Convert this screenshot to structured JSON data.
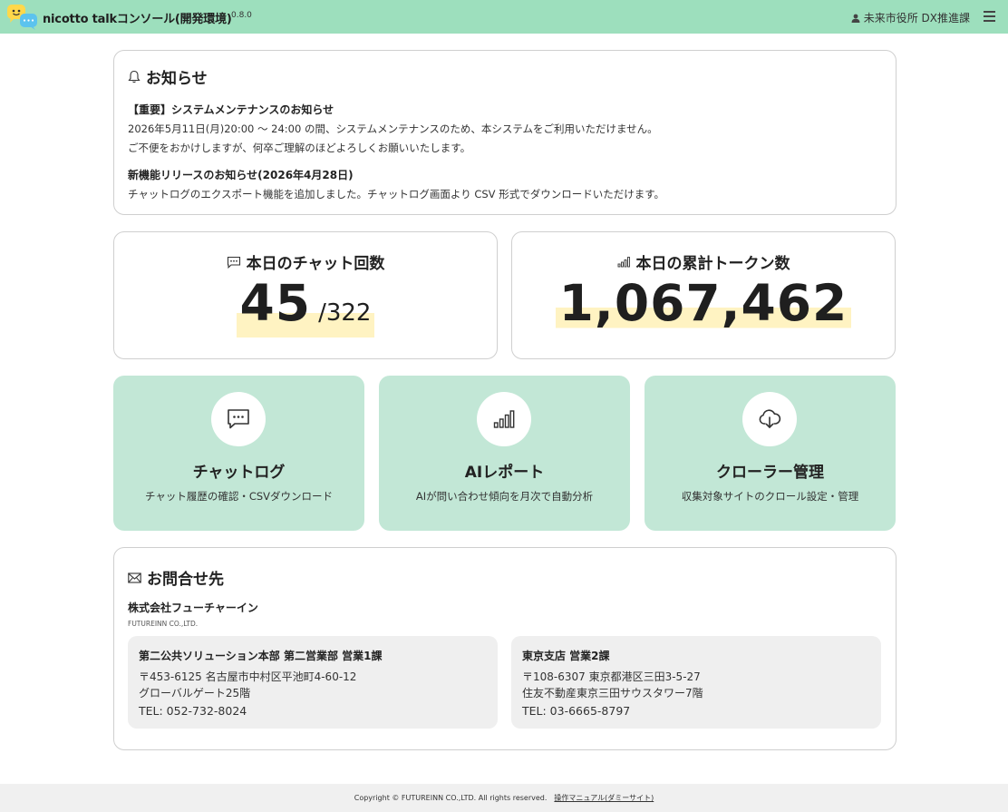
{
  "header": {
    "app_title": "nicotto talkコンソール(開発環境)",
    "version": "0.8.0",
    "user": "未来市役所 DX推進課"
  },
  "notice": {
    "title": "お知らせ",
    "items": [
      {
        "title": "【重要】システムメンテナンスのお知らせ",
        "lines": [
          "2026年5月11日(月)20:00 〜 24:00 の間、システムメンテナンスのため、本システムをご利用いただけません。",
          "ご不便をおかけしますが、何卒ご理解のほどよろしくお願いいたします。"
        ]
      },
      {
        "title": "新機能リリースのお知らせ(2026年4月28日)",
        "lines": [
          "チャットログのエクスポート機能を追加しました。チャットログ画面より CSV 形式でダウンロードいただけます。"
        ]
      }
    ]
  },
  "stats": {
    "chats": {
      "label": "本日のチャット回数",
      "value": "45",
      "total": "/322"
    },
    "tokens": {
      "label": "本日の累計トークン数",
      "value": "1,067,462"
    }
  },
  "tiles": [
    {
      "title": "チャットログ",
      "desc": "チャット履歴の確認・CSVダウンロード",
      "icon": "chat-bubble-icon"
    },
    {
      "title": "AIレポート",
      "desc": "AIが問い合わせ傾向を月次で自動分析",
      "icon": "bar-chart-icon"
    },
    {
      "title": "クローラー管理",
      "desc": "収集対象サイトのクロール設定・管理",
      "icon": "cloud-download-icon"
    }
  ],
  "contact": {
    "title": "お問合せ先",
    "company": "株式会社フューチャーイン",
    "company_en": "FUTUREINN CO.,LTD.",
    "offices": [
      {
        "name": "第二公共ソリューション本部 第二営業部 営業1課",
        "address1": "〒453-6125 名古屋市中村区平池町4-60-12",
        "address2": "グローバルゲート25階",
        "tel": "TEL: 052-732-8024"
      },
      {
        "name": "東京支店 営業2課",
        "address1": "〒108-6307 東京都港区三田3-5-27",
        "address2": "住友不動産東京三田サウスタワー7階",
        "tel": "TEL: 03-6665-8797"
      }
    ]
  },
  "footer": {
    "copyright": "Copyright © FUTUREINN CO.,LTD. All rights reserved.",
    "manual_link": "操作マニュアル(ダミーサイト)"
  },
  "colors": {
    "header_bg": "#9ddfbd",
    "tile_bg": "#c2e7d6",
    "highlight": "#fff3c2"
  }
}
